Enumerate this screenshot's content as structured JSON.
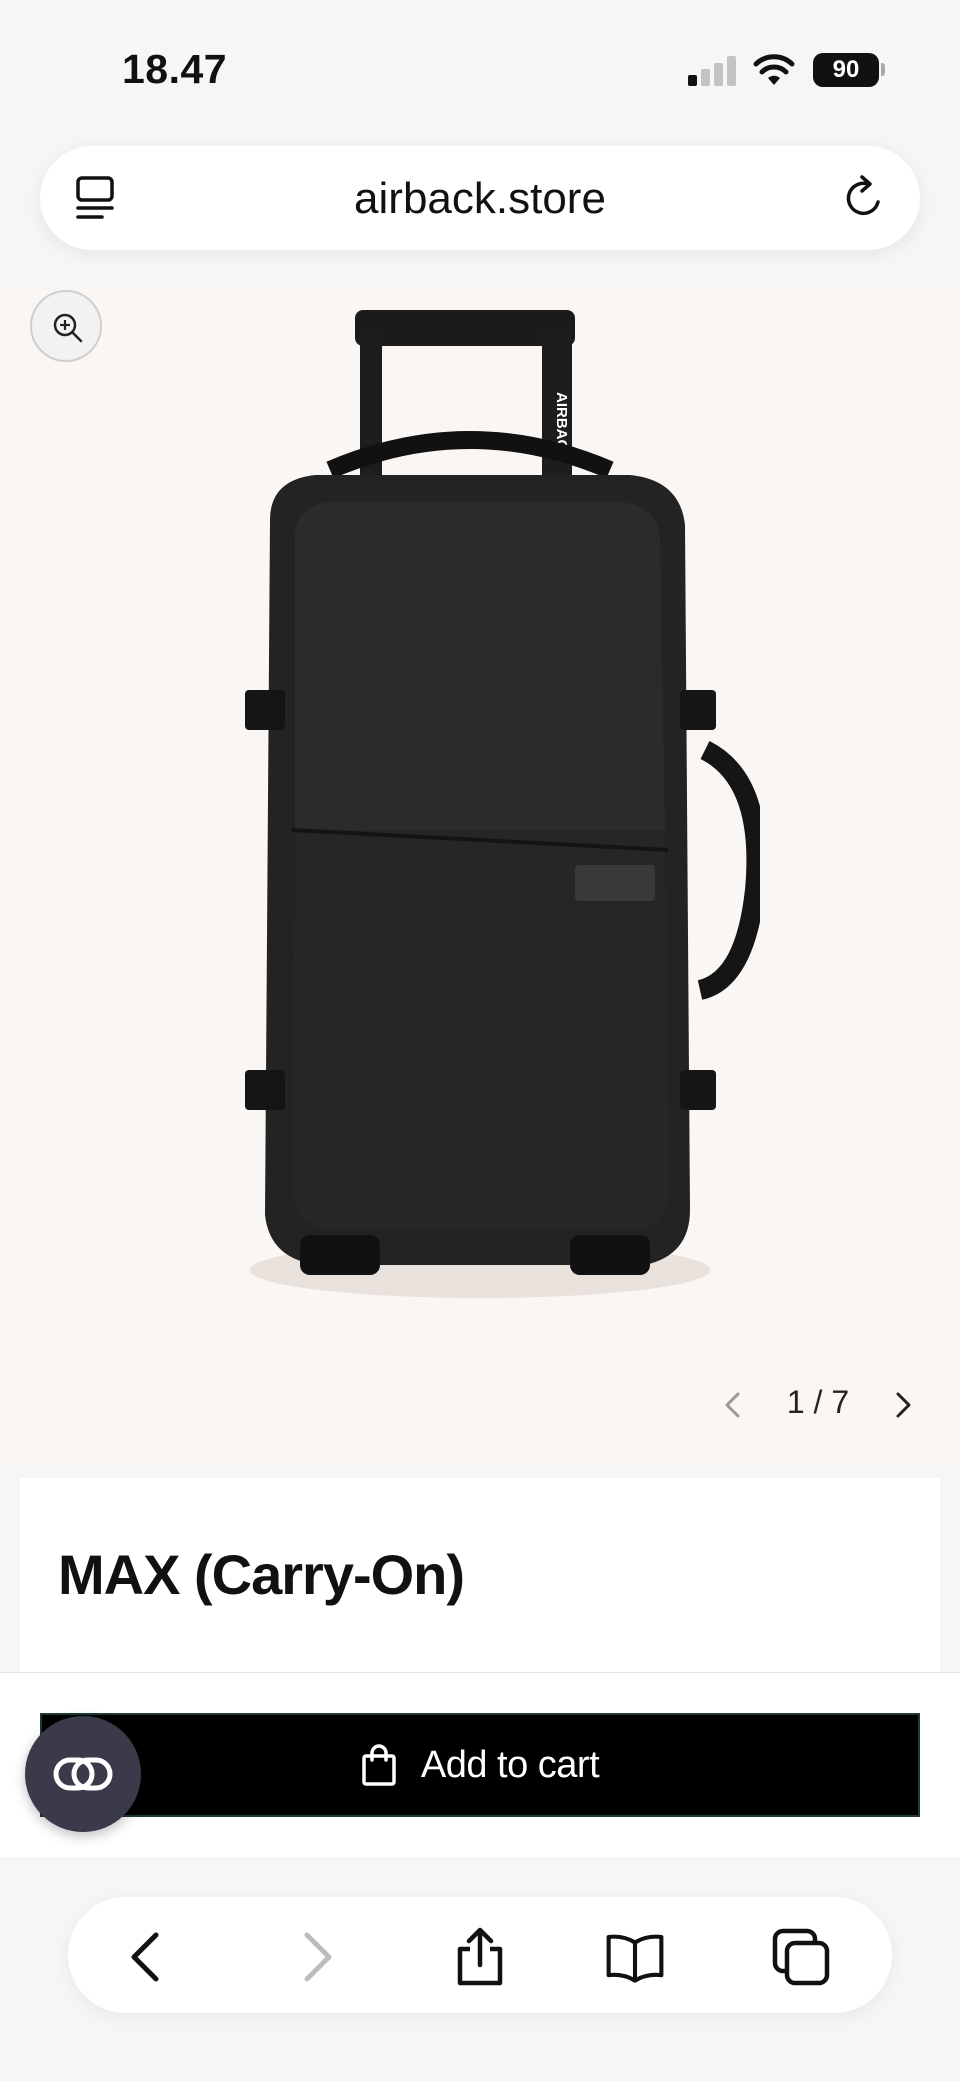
{
  "status_bar": {
    "time": "18.47",
    "battery": "90",
    "icons": [
      "cellular-signal-icon",
      "wifi-icon",
      "battery-icon"
    ]
  },
  "url_bar": {
    "url": "airback.store",
    "left_icon": "page-menu-icon",
    "right_icon": "reload-icon"
  },
  "gallery": {
    "zoom_icon": "zoom-in-icon",
    "current": "1",
    "total": "7",
    "counter_text": "1 / 7",
    "image_brand_text": "AIRBACK"
  },
  "product": {
    "title": "MAX (Carry-On)"
  },
  "cart": {
    "label": "Add to cart",
    "icon": "shopping-bag-icon"
  },
  "floating_badge": {
    "icon": "chat-link-icon"
  },
  "toolbar": {
    "items": [
      "back-icon",
      "forward-icon",
      "share-icon",
      "bookmarks-icon",
      "tabs-icon"
    ]
  },
  "colors": {
    "gallery_bg": "#faf6f4",
    "button_bg": "#000000",
    "badge_bg": "#3b3a4a",
    "chrome_bg": "#f6f6f6"
  }
}
